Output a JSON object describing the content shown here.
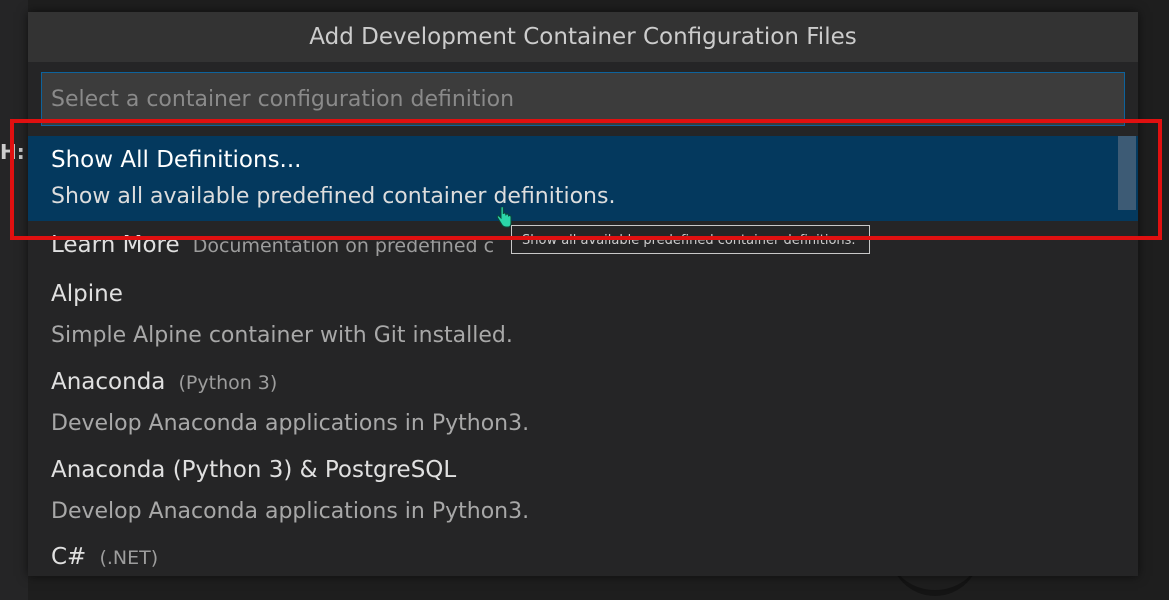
{
  "background": {
    "glyph": "H:"
  },
  "quick_pick": {
    "title": "Add Development Container Configuration Files",
    "input": {
      "value": "",
      "placeholder": "Select a container configuration definition"
    },
    "items": [
      {
        "label": "Show All Definitions...",
        "detail": "Show all available predefined container definitions.",
        "selected": true
      },
      {
        "label": "Learn More",
        "description": "Documentation on predefined c"
      },
      {
        "label": "Alpine",
        "detail": "Simple Alpine container with Git installed."
      },
      {
        "label": "Anaconda",
        "description": "(Python 3)",
        "detail": "Develop Anaconda applications in Python3."
      },
      {
        "label": "Anaconda (Python 3) & PostgreSQL",
        "detail": "Develop Anaconda applications in Python3."
      },
      {
        "label": "C#",
        "description": "(.NET)"
      }
    ]
  },
  "tooltip": {
    "text": "Show all available predefined container definitions."
  },
  "colors": {
    "selection_background": "#04395e",
    "highlight_border": "#e01010",
    "input_border": "#0e639c"
  },
  "icons": {
    "cursor": "hand-pointer-icon"
  }
}
